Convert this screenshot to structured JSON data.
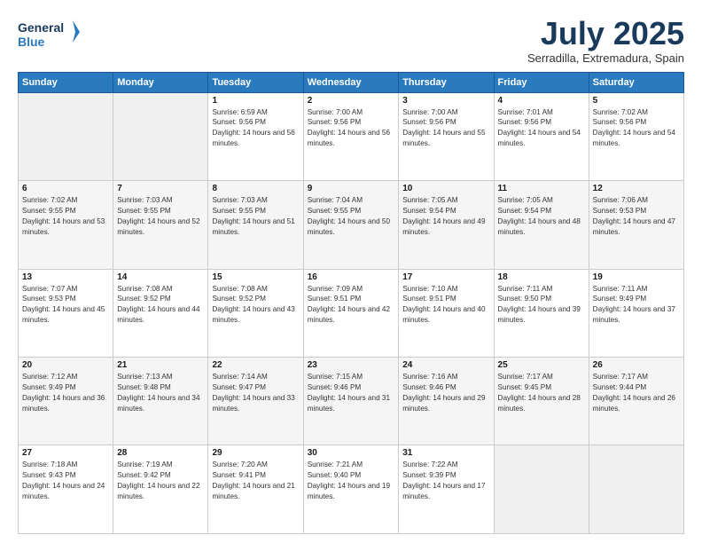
{
  "header": {
    "logo_line1": "General",
    "logo_line2": "Blue",
    "month": "July 2025",
    "location": "Serradilla, Extremadura, Spain"
  },
  "weekdays": [
    "Sunday",
    "Monday",
    "Tuesday",
    "Wednesday",
    "Thursday",
    "Friday",
    "Saturday"
  ],
  "weeks": [
    [
      {
        "day": "",
        "info": ""
      },
      {
        "day": "",
        "info": ""
      },
      {
        "day": "1",
        "info": "Sunrise: 6:59 AM\nSunset: 9:56 PM\nDaylight: 14 hours and 56 minutes."
      },
      {
        "day": "2",
        "info": "Sunrise: 7:00 AM\nSunset: 9:56 PM\nDaylight: 14 hours and 56 minutes."
      },
      {
        "day": "3",
        "info": "Sunrise: 7:00 AM\nSunset: 9:56 PM\nDaylight: 14 hours and 55 minutes."
      },
      {
        "day": "4",
        "info": "Sunrise: 7:01 AM\nSunset: 9:56 PM\nDaylight: 14 hours and 54 minutes."
      },
      {
        "day": "5",
        "info": "Sunrise: 7:02 AM\nSunset: 9:56 PM\nDaylight: 14 hours and 54 minutes."
      }
    ],
    [
      {
        "day": "6",
        "info": "Sunrise: 7:02 AM\nSunset: 9:55 PM\nDaylight: 14 hours and 53 minutes."
      },
      {
        "day": "7",
        "info": "Sunrise: 7:03 AM\nSunset: 9:55 PM\nDaylight: 14 hours and 52 minutes."
      },
      {
        "day": "8",
        "info": "Sunrise: 7:03 AM\nSunset: 9:55 PM\nDaylight: 14 hours and 51 minutes."
      },
      {
        "day": "9",
        "info": "Sunrise: 7:04 AM\nSunset: 9:55 PM\nDaylight: 14 hours and 50 minutes."
      },
      {
        "day": "10",
        "info": "Sunrise: 7:05 AM\nSunset: 9:54 PM\nDaylight: 14 hours and 49 minutes."
      },
      {
        "day": "11",
        "info": "Sunrise: 7:05 AM\nSunset: 9:54 PM\nDaylight: 14 hours and 48 minutes."
      },
      {
        "day": "12",
        "info": "Sunrise: 7:06 AM\nSunset: 9:53 PM\nDaylight: 14 hours and 47 minutes."
      }
    ],
    [
      {
        "day": "13",
        "info": "Sunrise: 7:07 AM\nSunset: 9:53 PM\nDaylight: 14 hours and 45 minutes."
      },
      {
        "day": "14",
        "info": "Sunrise: 7:08 AM\nSunset: 9:52 PM\nDaylight: 14 hours and 44 minutes."
      },
      {
        "day": "15",
        "info": "Sunrise: 7:08 AM\nSunset: 9:52 PM\nDaylight: 14 hours and 43 minutes."
      },
      {
        "day": "16",
        "info": "Sunrise: 7:09 AM\nSunset: 9:51 PM\nDaylight: 14 hours and 42 minutes."
      },
      {
        "day": "17",
        "info": "Sunrise: 7:10 AM\nSunset: 9:51 PM\nDaylight: 14 hours and 40 minutes."
      },
      {
        "day": "18",
        "info": "Sunrise: 7:11 AM\nSunset: 9:50 PM\nDaylight: 14 hours and 39 minutes."
      },
      {
        "day": "19",
        "info": "Sunrise: 7:11 AM\nSunset: 9:49 PM\nDaylight: 14 hours and 37 minutes."
      }
    ],
    [
      {
        "day": "20",
        "info": "Sunrise: 7:12 AM\nSunset: 9:49 PM\nDaylight: 14 hours and 36 minutes."
      },
      {
        "day": "21",
        "info": "Sunrise: 7:13 AM\nSunset: 9:48 PM\nDaylight: 14 hours and 34 minutes."
      },
      {
        "day": "22",
        "info": "Sunrise: 7:14 AM\nSunset: 9:47 PM\nDaylight: 14 hours and 33 minutes."
      },
      {
        "day": "23",
        "info": "Sunrise: 7:15 AM\nSunset: 9:46 PM\nDaylight: 14 hours and 31 minutes."
      },
      {
        "day": "24",
        "info": "Sunrise: 7:16 AM\nSunset: 9:46 PM\nDaylight: 14 hours and 29 minutes."
      },
      {
        "day": "25",
        "info": "Sunrise: 7:17 AM\nSunset: 9:45 PM\nDaylight: 14 hours and 28 minutes."
      },
      {
        "day": "26",
        "info": "Sunrise: 7:17 AM\nSunset: 9:44 PM\nDaylight: 14 hours and 26 minutes."
      }
    ],
    [
      {
        "day": "27",
        "info": "Sunrise: 7:18 AM\nSunset: 9:43 PM\nDaylight: 14 hours and 24 minutes."
      },
      {
        "day": "28",
        "info": "Sunrise: 7:19 AM\nSunset: 9:42 PM\nDaylight: 14 hours and 22 minutes."
      },
      {
        "day": "29",
        "info": "Sunrise: 7:20 AM\nSunset: 9:41 PM\nDaylight: 14 hours and 21 minutes."
      },
      {
        "day": "30",
        "info": "Sunrise: 7:21 AM\nSunset: 9:40 PM\nDaylight: 14 hours and 19 minutes."
      },
      {
        "day": "31",
        "info": "Sunrise: 7:22 AM\nSunset: 9:39 PM\nDaylight: 14 hours and 17 minutes."
      },
      {
        "day": "",
        "info": ""
      },
      {
        "day": "",
        "info": ""
      }
    ]
  ]
}
